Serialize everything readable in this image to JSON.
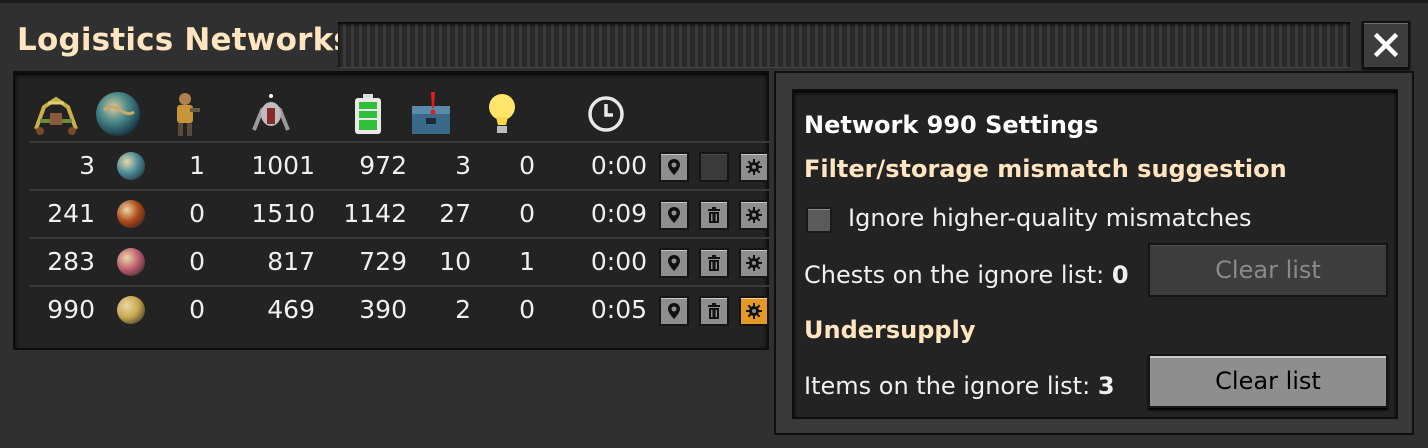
{
  "window": {
    "title": "Logistics Networks",
    "close_icon": "close-icon"
  },
  "header_icons": [
    "logistic-robot-icon",
    "planet-icon",
    "player-character-icon",
    "construction-robot-icon",
    "battery-charge-icon",
    "chest-alert-icon",
    "lightbulb-icon",
    "clock-icon"
  ],
  "rows": [
    {
      "id": "3",
      "planet_color": "#4a8a9a",
      "players": "1",
      "logistic_bots": "1001",
      "available": "972",
      "alerts": "3",
      "lights": "0",
      "time": "0:00",
      "delete_disabled": true,
      "selected": false
    },
    {
      "id": "241",
      "planet_color": "#b04a1a",
      "players": "0",
      "logistic_bots": "1510",
      "available": "1142",
      "alerts": "27",
      "lights": "0",
      "time": "0:09",
      "delete_disabled": false,
      "selected": false
    },
    {
      "id": "283",
      "planet_color": "#c06070",
      "players": "0",
      "logistic_bots": "817",
      "available": "729",
      "alerts": "10",
      "lights": "1",
      "time": "0:00",
      "delete_disabled": false,
      "selected": false
    },
    {
      "id": "990",
      "planet_color": "#c8a850",
      "players": "0",
      "logistic_bots": "469",
      "available": "390",
      "alerts": "2",
      "lights": "0",
      "time": "0:05",
      "delete_disabled": false,
      "selected": true
    }
  ],
  "settings": {
    "title": "Network 990 Settings",
    "filter_heading": "Filter/storage mismatch suggestion",
    "ignore_checkbox_label": "Ignore higher-quality mismatches",
    "ignore_checkbox_checked": false,
    "chests_label": "Chests on the ignore list: ",
    "chests_count": "0",
    "clear_list_label": "Clear list",
    "undersupply_heading": "Undersupply",
    "items_label": "Items on the ignore list: ",
    "items_count": "3",
    "clear_list_label_2": "Clear list"
  },
  "colors": {
    "heading": "#ffe6c0",
    "selected_button": "#e39827",
    "panel_bg": "#242324"
  }
}
